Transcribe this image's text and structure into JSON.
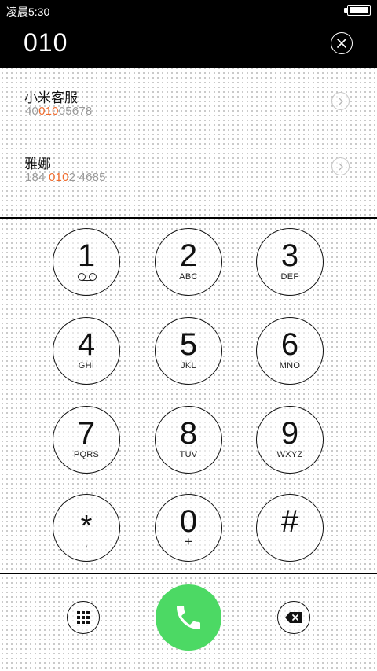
{
  "status_bar": {
    "time": "凌晨5:30",
    "battery_icon": "battery-full-icon"
  },
  "dial_input": {
    "number": "010",
    "clear_icon": "close-circle-icon"
  },
  "suggestions": [
    {
      "name": "小米客服",
      "number_pre": "40",
      "number_match": "010",
      "number_post": "05678",
      "detail_icon": "chevron-right-icon"
    },
    {
      "name": "雅娜",
      "number_pre": "184 ",
      "number_match": "010",
      "number_post": "2 4685",
      "detail_icon": "chevron-right-icon"
    }
  ],
  "keypad": [
    {
      "digit": "1",
      "letters": ""
    },
    {
      "digit": "2",
      "letters": "ABC"
    },
    {
      "digit": "3",
      "letters": "DEF"
    },
    {
      "digit": "4",
      "letters": "GHI"
    },
    {
      "digit": "5",
      "letters": "JKL"
    },
    {
      "digit": "6",
      "letters": "MNO"
    },
    {
      "digit": "7",
      "letters": "PQRS"
    },
    {
      "digit": "8",
      "letters": "TUV"
    },
    {
      "digit": "9",
      "letters": "WXYZ"
    },
    {
      "digit": "*",
      "letters": ","
    },
    {
      "digit": "0",
      "letters": "+"
    },
    {
      "digit": "#",
      "letters": ""
    }
  ],
  "bottom_bar": {
    "dialpad_icon": "dialpad-grid-icon",
    "call_icon": "phone-icon",
    "backspace_icon": "backspace-icon"
  },
  "colors": {
    "accent_highlight": "#ef6a2c",
    "call_green": "#4cd964",
    "header_bg": "#000000"
  }
}
